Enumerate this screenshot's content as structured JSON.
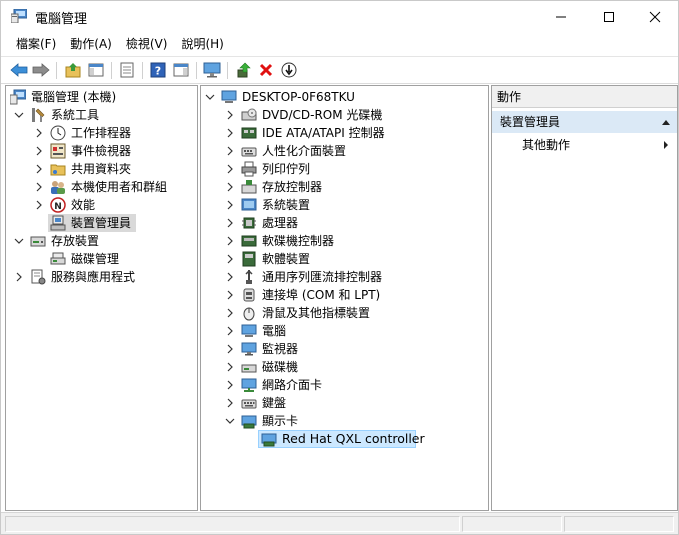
{
  "window": {
    "title": "電腦管理"
  },
  "menu": [
    "檔案(F)",
    "動作(A)",
    "檢視(V)",
    "說明(H)"
  ],
  "toolbar": {
    "buttons": [
      "back-icon",
      "forward-icon",
      "up-folder-icon",
      "show-hide-tree-icon",
      "properties-icon",
      "help-icon",
      "show-action-pane-icon",
      "monitor-icon",
      "update-driver-icon",
      "uninstall-icon",
      "disable-device-icon"
    ]
  },
  "tree": {
    "root": "電腦管理 (本機)",
    "system_tools": "系統工具",
    "items_system": [
      "工作排程器",
      "事件檢視器",
      "共用資料夾",
      "本機使用者和群組",
      "效能",
      "裝置管理員"
    ],
    "storage": "存放裝置",
    "items_storage": [
      "磁碟管理"
    ],
    "services": "服務與應用程式"
  },
  "devices": {
    "computer_name": "DESKTOP-0F68TKU",
    "categories": [
      "DVD/CD-ROM 光碟機",
      "IDE ATA/ATAPI 控制器",
      "人性化介面裝置",
      "列印佇列",
      "存放控制器",
      "系統裝置",
      "處理器",
      "軟碟機控制器",
      "軟體裝置",
      "通用序列匯流排控制器",
      "連接埠 (COM 和 LPT)",
      "滑鼠及其他指標裝置",
      "電腦",
      "監視器",
      "磁碟機",
      "網路介面卡",
      "鍵盤",
      "顯示卡"
    ],
    "expanded_child": "Red Hat QXL controller"
  },
  "actions": {
    "header": "動作",
    "section": "裝置管理員",
    "item": "其他動作"
  }
}
